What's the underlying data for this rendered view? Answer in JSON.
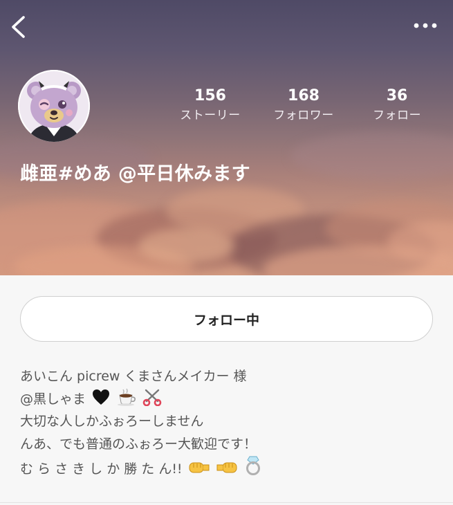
{
  "header": {
    "back_icon": "chevron-left-icon",
    "more_icon": "more-horizontal-icon"
  },
  "profile": {
    "name": "雌亜#めあ  @平日休みます",
    "stats": [
      {
        "value": "156",
        "label": "ストーリー"
      },
      {
        "value": "168",
        "label": "フォロワー"
      },
      {
        "value": "36",
        "label": "フォロー"
      }
    ]
  },
  "follow_button": {
    "label": "フォロー中"
  },
  "bio": {
    "lines": [
      "あいこん picrew くまさんメイカー 様",
      "@黒しゃま",
      "大切な人しかふぉろーしません",
      "んあ、でも普通のふぉろー大歓迎です！",
      "む ら さ き し か 勝 た ん!!"
    ],
    "line2_emoji": [
      "black-heart-icon",
      "coffee-icon",
      "scissors-icon"
    ],
    "line5_emoji": [
      "fist-bump-right-icon",
      "fist-bump-left-icon",
      "ring-icon"
    ]
  },
  "colors": {
    "cover_top": "#4f4a66",
    "cover_bottom": "#d29a80",
    "page_bg": "#f7f7f7",
    "text_body": "#555555"
  }
}
